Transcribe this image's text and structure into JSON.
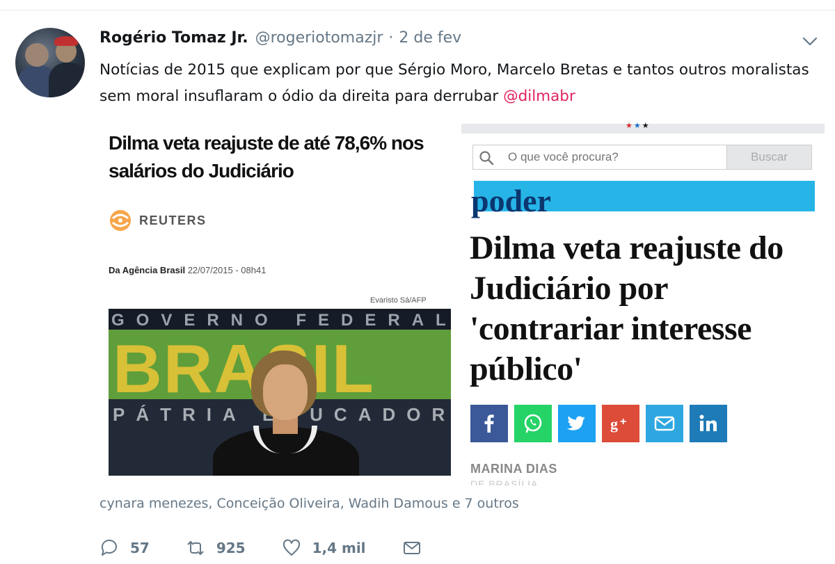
{
  "tweet": {
    "author_name": "Rogério Tomaz Jr.",
    "handle": "@rogeriotomazjr",
    "separator": "·",
    "time": "2 de fev",
    "text_before": "Notícias de 2015 que explicam por que Sérgio Moro, Marcelo Bretas e tantos outros moralistas sem moral insuflaram o ódio da direita para derrubar ",
    "mention": "@dilmabr",
    "liked_by": "cynara menezes, Conceição Oliveira, Wadih Damous e 7 outros"
  },
  "left_article": {
    "headline": "Dilma veta reajuste de até 78,6% nos salários do Judiciário",
    "source": "REUTERS",
    "byline_source": "Da Agência Brasil",
    "byline_date": "22/07/2015 - 08h41",
    "photo_credit": "Evaristo Sá/AFP",
    "photo_text_top": "GOVERNO FEDERAL",
    "photo_text_big": "BRASIL",
    "photo_text_bottom": "PÁTRIA EDUCADORA"
  },
  "right_article": {
    "search_placeholder": "O que você procura?",
    "search_button": "Buscar",
    "section": "poder",
    "headline": "Dilma veta reajuste do Judiciário por 'contrariar interesse público'",
    "author": "MARINA DIAS",
    "author_sub": "DE BRASÍLIA",
    "share_colors": {
      "facebook": "#3b5998",
      "whatsapp": "#25d366",
      "twitter": "#1da1f2",
      "googleplus": "#dd4b39",
      "email": "#2ea7e0",
      "linkedin": "#1e7bb7"
    }
  },
  "actions": {
    "replies": "57",
    "retweets": "925",
    "likes": "1,4 mil"
  },
  "colors": {
    "mention": "#e0245e",
    "secondary_text": "#657786",
    "poder_bar": "#27b5e8"
  }
}
